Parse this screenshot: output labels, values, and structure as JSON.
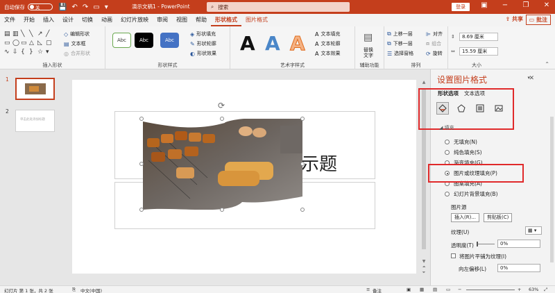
{
  "titlebar": {
    "autosave_label": "自动保存",
    "autosave_state": "关",
    "doc_title": "演示文稿1 - PowerPoint",
    "search_placeholder": "搜索",
    "login_label": "登录"
  },
  "menu": {
    "tabs": [
      "文件",
      "开始",
      "插入",
      "设计",
      "切换",
      "动画",
      "幻灯片放映",
      "审阅",
      "视图",
      "帮助",
      "形状格式",
      "图片格式"
    ],
    "active_tab": "形状格式",
    "share_label": "共享",
    "comment_label": "批注"
  },
  "ribbon": {
    "insert_shapes": {
      "label": "插入形状",
      "edit_shape": "编辑形状",
      "text_box": "文本框",
      "merge_shapes": "合并形状"
    },
    "shape_styles": {
      "label": "形状样式",
      "samples": [
        "Abc",
        "Abc",
        "Abc"
      ],
      "fill": "形状填充",
      "outline": "形状轮廓",
      "effects": "形状效果"
    },
    "wordart": {
      "label": "艺术字样式",
      "samples": [
        "A",
        "A",
        "A"
      ],
      "text_fill": "文本填充",
      "text_outline": "文本轮廓",
      "text_effects": "文本效果"
    },
    "accessibility": {
      "label": "辅助功能",
      "alt_text": "替换文字"
    },
    "arrange": {
      "label": "排列",
      "bring_forward": "上移一层",
      "send_backward": "下移一层",
      "selection_pane": "选择窗格",
      "align": "对齐",
      "group": "组合",
      "rotate": "旋转"
    },
    "size": {
      "label": "大小",
      "height": "8.69 厘米",
      "width": "15.59 厘米"
    }
  },
  "slides_panel": {
    "numbers": [
      "1",
      "2"
    ],
    "thumb2_text": "单击此处添加标题"
  },
  "slide": {
    "title_text": "示题"
  },
  "format_pane": {
    "title": "设置图片格式",
    "tabs": [
      "形状选项",
      "文本选项"
    ],
    "section": "填充",
    "fill_options": [
      "无填充(N)",
      "纯色填充(S)",
      "渐变填充(G)",
      "图片或纹理填充(P)",
      "图案填充(A)",
      "幻灯片背景填充(B)"
    ],
    "selected_fill": "图片或纹理填充(P)",
    "picture_source_label": "图片源",
    "insert_button": "插入(R)...",
    "clipboard_button": "剪贴板(C)",
    "texture_label": "纹理(U)",
    "transparency_label": "透明度(T)",
    "transparency_value": "0%",
    "tile_label": "将图片平铺为纹理(I)",
    "offset_left_label": "向左偏移(L)",
    "offset_left_value": "0%"
  },
  "status": {
    "slide_info": "幻灯片 第 1 张，共 2 张",
    "language": "中文(中国)",
    "notes": "备注",
    "zoom": "63%"
  },
  "colors": {
    "accent": "#c43e1c",
    "highlight_box": "#e0292a"
  }
}
